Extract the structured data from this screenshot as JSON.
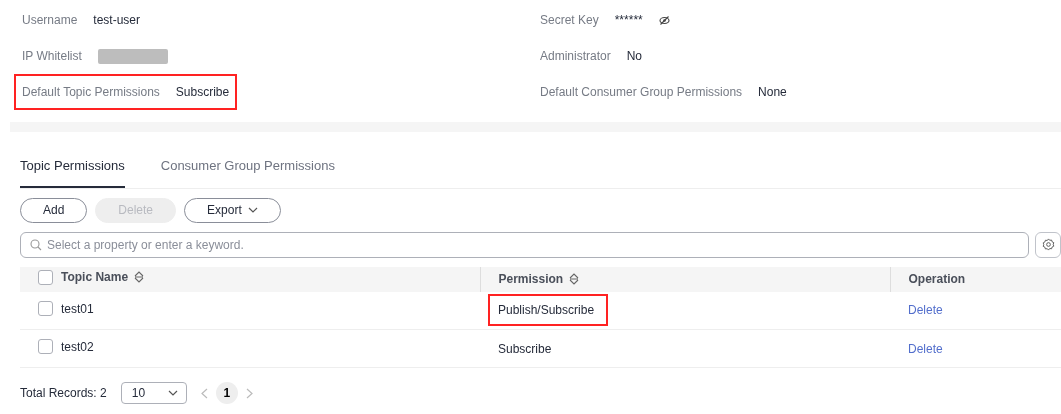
{
  "details": [
    {
      "label": "Username",
      "value": "test-user",
      "kind": "text",
      "highlighted": false
    },
    {
      "label": "Secret Key",
      "value": "******",
      "kind": "secret",
      "highlighted": false
    },
    {
      "label": "IP Whitelist",
      "kind": "redacted",
      "highlighted": false
    },
    {
      "label": "Administrator",
      "value": "No",
      "kind": "text",
      "highlighted": false
    },
    {
      "label": "Default Topic Permissions",
      "value": "Subscribe",
      "kind": "text",
      "highlighted": true
    },
    {
      "label": "Default Consumer Group Permissions",
      "value": "None",
      "kind": "text",
      "highlighted": false
    }
  ],
  "tabs": [
    {
      "label": "Topic Permissions",
      "selected": true
    },
    {
      "label": "Consumer Group Permissions",
      "selected": false
    }
  ],
  "toolbar": [
    {
      "label": "Add",
      "disabled": false,
      "kind": "plain"
    },
    {
      "label": "Delete",
      "disabled": true,
      "kind": "plain"
    },
    {
      "label": "Export",
      "disabled": false,
      "kind": "dropdown"
    }
  ],
  "search": {
    "placeholder": "Select a property or enter a keyword."
  },
  "table": {
    "select_all_checked": false,
    "columns": [
      {
        "label": "Topic Name",
        "sortable": true
      },
      {
        "label": "Permission",
        "sortable": true
      },
      {
        "label": "Operation",
        "sortable": false
      }
    ],
    "rows": [
      {
        "checked": false,
        "topic": "test01",
        "permission": "Publish/Subscribe",
        "permission_highlighted": true,
        "operation": "Delete"
      },
      {
        "checked": false,
        "topic": "test02",
        "permission": "Subscribe",
        "permission_highlighted": false,
        "operation": "Delete"
      }
    ]
  },
  "pagination": {
    "total": "Total Records: 2",
    "page_size": "10",
    "pages": [
      {
        "label": "1",
        "selected": true
      }
    ]
  }
}
